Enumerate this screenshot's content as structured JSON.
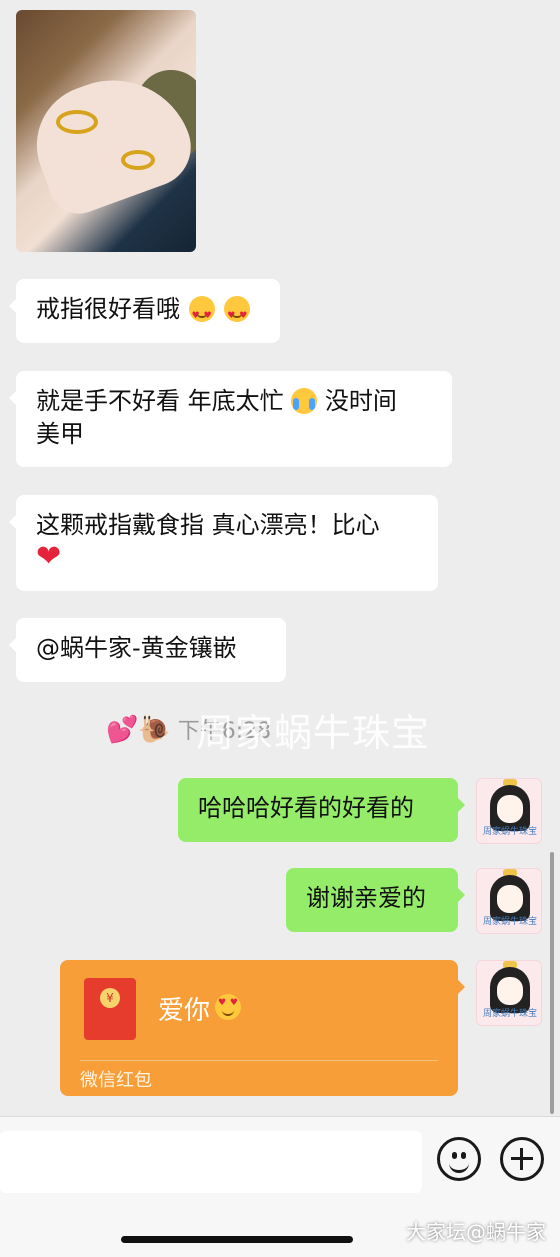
{
  "messages": [
    {
      "side": "left",
      "type": "image",
      "description": "hand-with-rings-photo"
    },
    {
      "side": "left",
      "type": "text",
      "text": "戒指很好看哦",
      "emoji": "heart-eyes"
    },
    {
      "side": "left",
      "type": "text",
      "line1_a": "就是手不好看 年底太忙",
      "line1_b": "没时间",
      "line2": "美甲"
    },
    {
      "side": "left",
      "type": "text",
      "line1": "这颗戒指戴食指 真心漂亮！比心"
    },
    {
      "side": "left",
      "type": "text",
      "text": "@蜗牛家-黄金镶嵌"
    },
    {
      "side": "right",
      "type": "text",
      "text": "哈哈哈好看的好看的"
    },
    {
      "side": "right",
      "type": "text",
      "text": "谢谢亲爱的"
    }
  ],
  "system": {
    "emoji_prefix": "💕🐌",
    "time": "下午6:28",
    "watermark": "周家蜗牛珠宝"
  },
  "red_packet": {
    "message": "爱你",
    "label": "微信红包",
    "coin": "¥",
    "color": "#f79e39"
  },
  "avatar": {
    "caption": "周家蜗牛珠宝"
  },
  "site_watermark": "大家坛@蜗牛家",
  "colors": {
    "chat_bg": "#ededed",
    "bubble_right": "#95ec69",
    "bubble_left": "#ffffff"
  }
}
